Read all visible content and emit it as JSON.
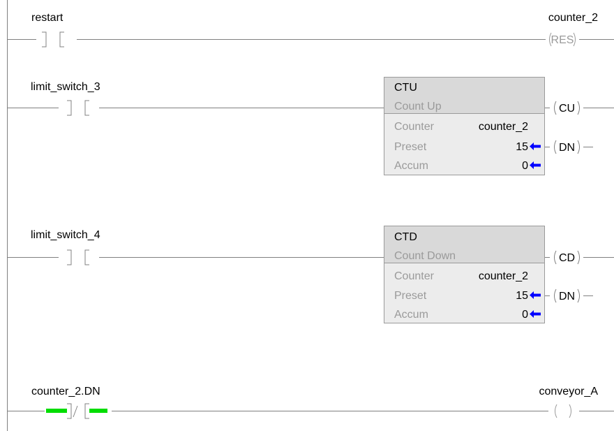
{
  "rungs": [
    {
      "contact": {
        "tag": "restart",
        "type": "XIC",
        "energized": false
      },
      "coil": {
        "tag": "counter_2",
        "symbol": "RES",
        "active": false
      }
    },
    {
      "contact": {
        "tag": "limit_switch_3",
        "type": "XIC",
        "energized": false
      },
      "block": {
        "mnemonic": "CTU",
        "title": "Count Up",
        "rows": [
          {
            "label": "Counter",
            "value": "counter_2"
          },
          {
            "label": "Preset",
            "value": "15"
          },
          {
            "label": "Accum",
            "value": "0"
          }
        ],
        "outputs": [
          "CU",
          "DN"
        ]
      }
    },
    {
      "contact": {
        "tag": "limit_switch_4",
        "type": "XIC",
        "energized": false
      },
      "block": {
        "mnemonic": "CTD",
        "title": "Count Down",
        "rows": [
          {
            "label": "Counter",
            "value": "counter_2"
          },
          {
            "label": "Preset",
            "value": "15"
          },
          {
            "label": "Accum",
            "value": "0"
          }
        ],
        "outputs": [
          "CD",
          "DN"
        ]
      }
    },
    {
      "contact": {
        "tag": "counter_2.DN",
        "type": "XIO",
        "energized": true
      },
      "coil": {
        "tag": "conveyor_A",
        "symbol": "",
        "active": false
      }
    }
  ],
  "colors": {
    "rail": "#808080",
    "energized": "#00dd00",
    "arrow": "#0000ff",
    "block_header": "#d9d9d9",
    "block_body": "#ececec",
    "dim_text": "#9a9a9a"
  }
}
